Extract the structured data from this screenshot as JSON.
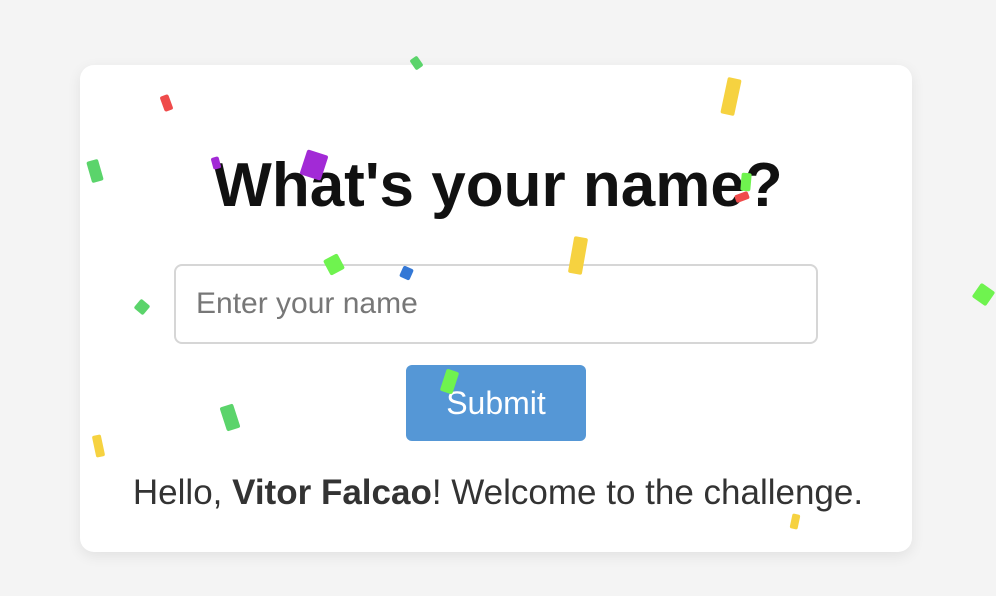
{
  "page": {
    "background": "#f4f4f4",
    "card_background": "#ffffff"
  },
  "form": {
    "title": "What's your name?",
    "input_placeholder": "Enter your name",
    "input_value": "",
    "submit_label": "Submit",
    "submit_color": "#5597d6"
  },
  "greeting": {
    "prefix": "Hello, ",
    "name": "Vitor Falcao",
    "suffix": "! Welcome to the challenge."
  },
  "confetti_colors": {
    "red": "#ef4b4b",
    "green": "#5bd46b",
    "light_green": "#6ff34f",
    "purple": "#a22ad6",
    "blue": "#3478d6",
    "yellow": "#f6d240"
  }
}
